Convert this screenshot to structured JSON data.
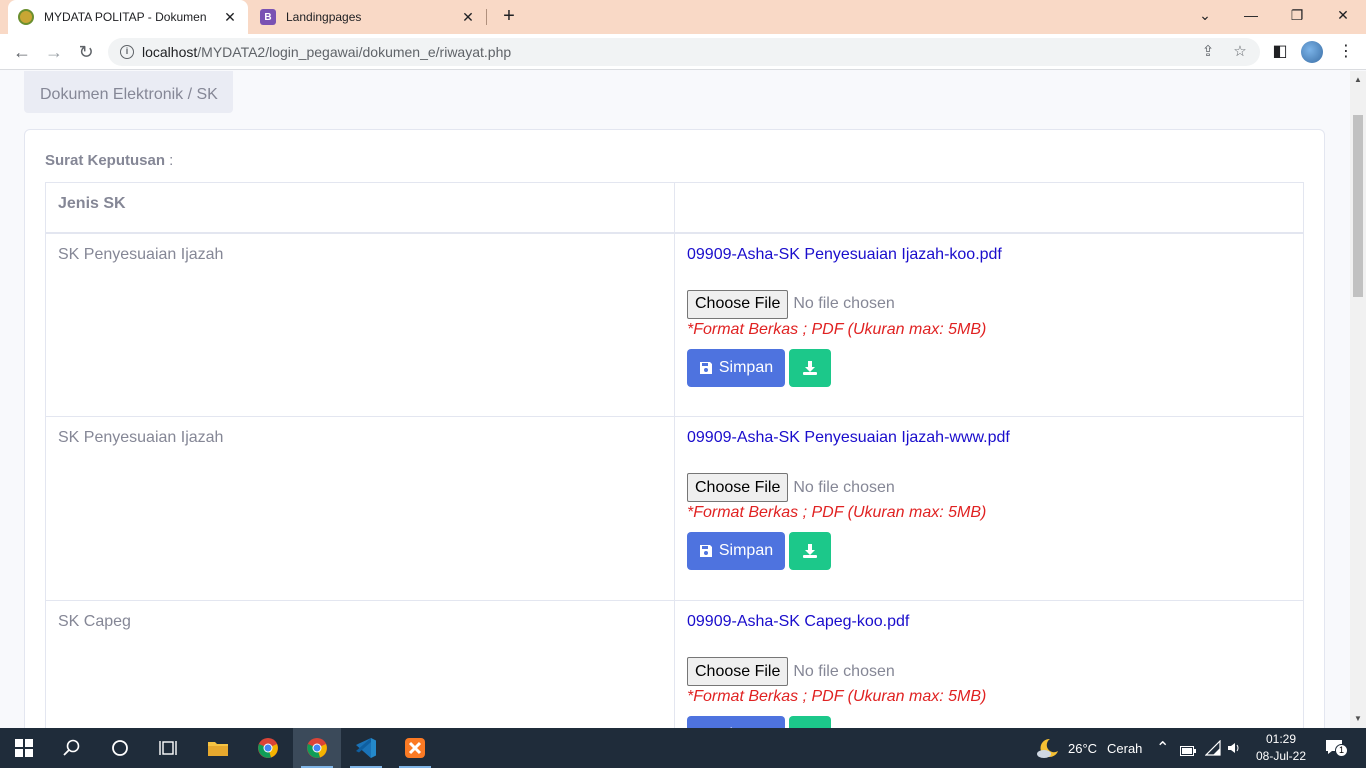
{
  "browser": {
    "tabs": [
      {
        "title": "MYDATA POLITAP - Dokumen",
        "active": true
      },
      {
        "title": "Landingpages",
        "active": false
      }
    ],
    "url_host": "localhost",
    "url_path": "/MYDATA2/login_pegawai/dokumen_e/riwayat.php"
  },
  "page": {
    "breadcrumb": "Dokumen Elektronik / SK",
    "section_label": "Surat Keputusan",
    "section_colon": " :",
    "table_header": "Jenis SK",
    "rows": [
      {
        "jenis": "SK Penyesuaian Ijazah",
        "file": "09909-Asha-SK Penyesuaian Ijazah-koo.pdf"
      },
      {
        "jenis": "SK Penyesuaian Ijazah",
        "file": "09909-Asha-SK Penyesuaian Ijazah-www.pdf"
      },
      {
        "jenis": "SK Capeg",
        "file": "09909-Asha-SK Capeg-koo.pdf"
      }
    ],
    "choose_file_label": "Choose File",
    "no_file_label": "No file chosen",
    "format_note": "*Format Berkas ; PDF (Ukuran max: 5MB)",
    "save_label": "Simpan"
  },
  "taskbar": {
    "weather_temp": "26°C",
    "weather_desc": "Cerah",
    "time": "01:29",
    "date": "08-Jul-22",
    "notification_count": "1"
  },
  "colors": {
    "primary": "#4e73df",
    "success": "#1cc88a",
    "danger": "#e02222",
    "link": "#1a0dcc",
    "tabstrip": "#f9d9c6"
  }
}
